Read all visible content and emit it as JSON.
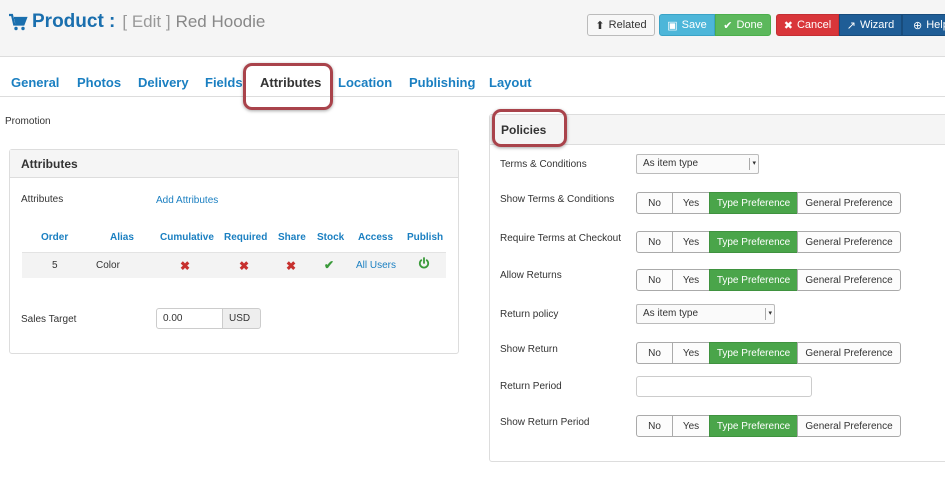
{
  "header": {
    "title": "Product :",
    "edit_label": "[ Edit ]",
    "item_name": "Red Hoodie",
    "icon": "shopping-cart-icon"
  },
  "toolbar": {
    "related": "Related",
    "save": "Save",
    "done": "Done",
    "cancel": "Cancel",
    "wizard": "Wizard",
    "help": "Help"
  },
  "tabs": [
    {
      "label": "General"
    },
    {
      "label": "Photos"
    },
    {
      "label": "Delivery"
    },
    {
      "label": "Fields"
    },
    {
      "label": "Attributes",
      "active": true
    },
    {
      "label": "Location"
    },
    {
      "label": "Publishing"
    },
    {
      "label": "Layout"
    }
  ],
  "promotion_label": "Promotion",
  "attributes_panel": {
    "title": "Attributes",
    "attributes_label": "Attributes",
    "add_link": "Add Attributes",
    "columns": [
      "Order",
      "Alias",
      "Cumulative",
      "Required",
      "Share",
      "Stock",
      "Access",
      "Publish"
    ],
    "rows": [
      {
        "order": "5",
        "alias": "Color",
        "cumulative": "no",
        "required": "no",
        "share": "no",
        "stock": "yes",
        "access": "All Users",
        "publish": "published"
      }
    ],
    "sales_target_label": "Sales Target",
    "sales_target_value": "0.00",
    "currency": "USD"
  },
  "policies_panel": {
    "title": "Policies",
    "terms_label": "Terms & Conditions",
    "terms_select": "As item type",
    "show_terms_label": "Show Terms & Conditions",
    "require_terms_label": "Require Terms at Checkout",
    "allow_returns_label": "Allow Returns",
    "return_policy_label": "Return policy",
    "return_policy_select": "As item type",
    "show_return_label": "Show Return",
    "return_period_label": "Return Period",
    "return_period_value": "",
    "show_return_period_label": "Show Return Period",
    "options": {
      "no": "No",
      "yes": "Yes",
      "type": "Type Preference",
      "general": "General Preference"
    },
    "selected_option": "Type Preference"
  },
  "colors": {
    "brand_blue": "#1a6fae",
    "link_blue": "#1a7fc1",
    "active_green": "#4aa54a",
    "highlight_red": "#a9434b"
  }
}
